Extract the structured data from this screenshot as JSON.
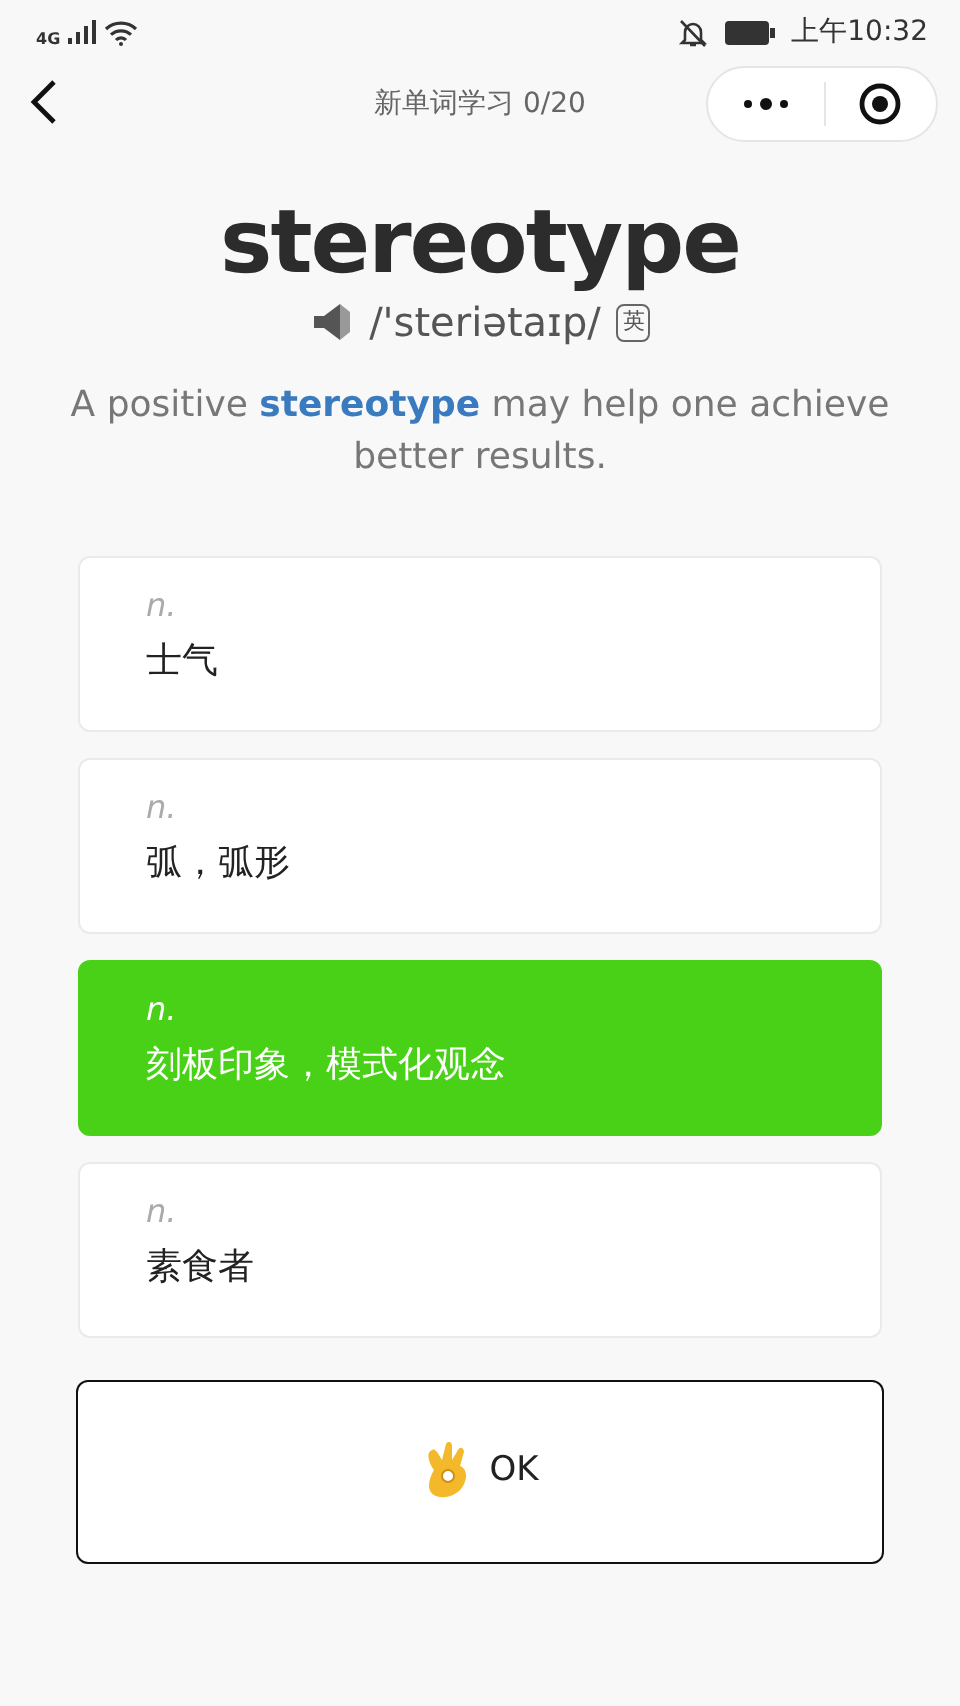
{
  "status_bar": {
    "network": "4G",
    "time": "上午10:32"
  },
  "nav": {
    "title": "新单词学习 0/20"
  },
  "word": {
    "text": "stereotype",
    "phonetic": "/'steriətaɪp/",
    "accent": "英"
  },
  "example": "A positive **stereotype** may help one achieve better results.",
  "options": [
    {
      "pos": "n.",
      "meaning": "士气",
      "selected": false
    },
    {
      "pos": "n.",
      "meaning": "弧，弧形",
      "selected": false
    },
    {
      "pos": "n.",
      "meaning": "刻板印象，模式化观念",
      "selected": true
    },
    {
      "pos": "n.",
      "meaning": "素食者",
      "selected": false
    }
  ],
  "ok_button": {
    "label": "OK"
  }
}
